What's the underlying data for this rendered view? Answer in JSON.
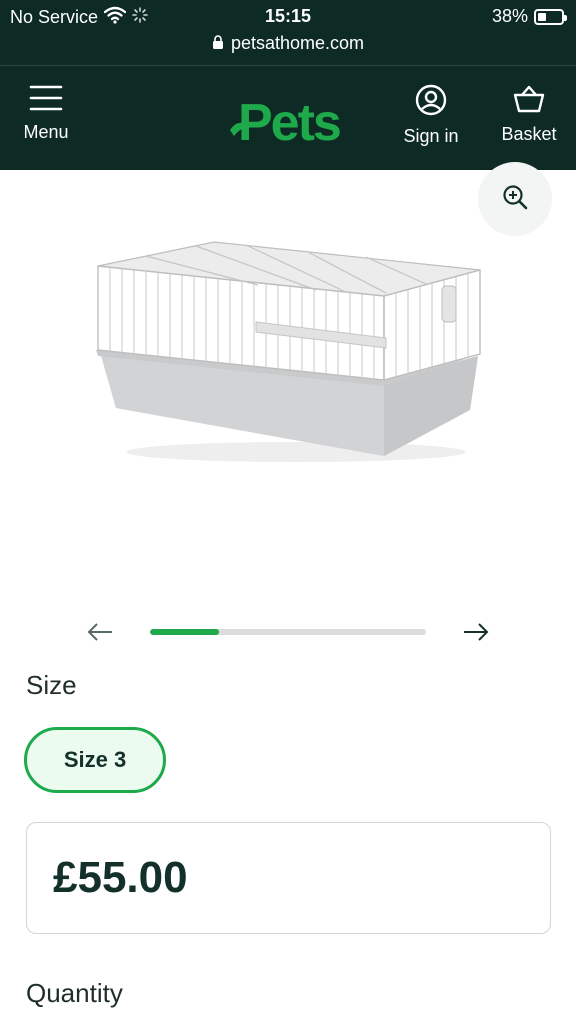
{
  "status_bar": {
    "carrier": "No Service",
    "time": "15:15",
    "battery": "38%",
    "battery_level": 0.38
  },
  "browser": {
    "url": "petsathome.com"
  },
  "header": {
    "menu_label": "Menu",
    "logo_text": "Pets",
    "signin_label": "Sign in",
    "basket_label": "Basket"
  },
  "gallery": {
    "progress": 0.25,
    "icons": [
      "zoom-in-icon",
      "arrow-left-icon",
      "arrow-right-icon"
    ]
  },
  "product": {
    "size_label": "Size",
    "selected_size": "Size 3",
    "price": "£55.00",
    "quantity_label": "Quantity"
  },
  "colors": {
    "header_bg": "#0d2a24",
    "brand_green": "#1ea94a",
    "chip_bg": "#ecfbf0"
  }
}
